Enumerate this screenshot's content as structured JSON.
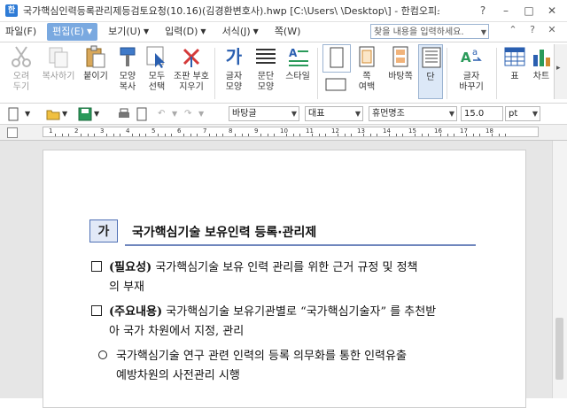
{
  "window": {
    "title": "국가핵심인력등록관리제등검토요청(10.16)(김경환변호사).hwp [C:\\Users\\  \\Desktop\\] - 한컴오피스 한글",
    "app_icon_label": "한"
  },
  "menubar": {
    "items": [
      "파일(F)",
      "편집(E)",
      "보기(U)",
      "입력(D)",
      "서식(J)",
      "쪽(W)"
    ],
    "active": "편집(E)",
    "search_placeholder": "찾을 내용을 입력하세요."
  },
  "ribbon": {
    "buttons": [
      {
        "label": "오려\n두기",
        "icon": "scissors-icon"
      },
      {
        "label": "복사하기",
        "icon": "copy-icon"
      },
      {
        "label": "붙이기",
        "icon": "paste-icon"
      },
      {
        "label": "모양\n복사",
        "icon": "format-painter-icon"
      },
      {
        "label": "모두\n선택",
        "icon": "select-all-icon"
      },
      {
        "label": "조판 부호\n지우기",
        "icon": "clear-marks-icon"
      },
      {
        "label": "글자\n모양",
        "icon": "char-shape-icon",
        "glyph": "가"
      },
      {
        "label": "문단\n모양",
        "icon": "para-shape-icon"
      },
      {
        "label": "스타일",
        "icon": "style-icon"
      },
      {
        "label": "쪽\n여백",
        "icon": "page-margin-icon"
      },
      {
        "label": "바탕쪽",
        "icon": "master-page-icon"
      },
      {
        "label": "단",
        "icon": "columns-icon"
      },
      {
        "label": "글자\n바꾸기",
        "icon": "change-char-icon"
      },
      {
        "label": "표",
        "icon": "table-icon"
      },
      {
        "label": "차트",
        "icon": "chart-icon"
      }
    ]
  },
  "toolbar2": {
    "style": "바탕글",
    "lang": "대표",
    "font": "휴먼명조",
    "size": "15.0",
    "unit": "pt"
  },
  "ruler": {
    "numbers": [
      "1",
      "2",
      "3",
      "4",
      "5",
      "6",
      "7",
      "8",
      "9",
      "10",
      "11",
      "12",
      "13",
      "14",
      "15",
      "16",
      "17",
      "18"
    ]
  },
  "document": {
    "heading_box": "가",
    "heading": "국가핵심기술 보유인력 등록·관리제",
    "paragraphs": [
      {
        "marker": "box",
        "bold": "(필요성)",
        "text": " 국가핵심기술 보유 인력 관리를 위한 근거 규정 및 정책",
        "line2": "의 부재"
      },
      {
        "marker": "box",
        "bold": "(주요내용)",
        "text": " 국가핵심기술 보유기관별로 “국가핵심기술자” 를 추천받",
        "line2": "아 국가 차원에서 지정, 관리"
      },
      {
        "marker": "circle",
        "bold": "",
        "text": "국가핵심기술 연구 관련 인력의 등록 의무화를 통한 인력유출",
        "line2": "예방차원의 사전관리 시행"
      }
    ]
  }
}
